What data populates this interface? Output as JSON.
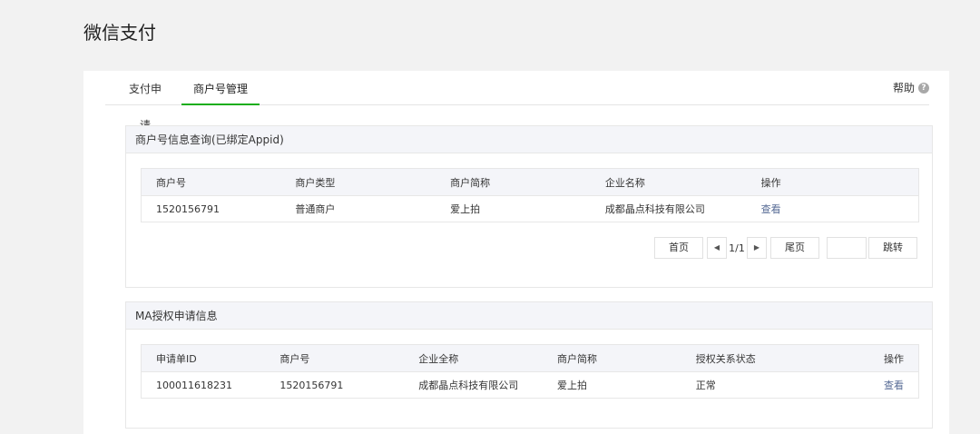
{
  "page": {
    "title": "微信支付"
  },
  "tabs": [
    {
      "label": "支付申请"
    },
    {
      "label": "商户号管理",
      "active": true
    }
  ],
  "help": {
    "label": "帮助",
    "icon": "question-icon",
    "glyph": "?"
  },
  "merchant_section": {
    "title": "商户号信息查询(已绑定Appid)",
    "columns": [
      "商户号",
      "商户类型",
      "商户简称",
      "企业名称",
      "操作"
    ],
    "rows": [
      {
        "merchant_id": "1520156791",
        "type": "普通商户",
        "short_name": "爱上拍",
        "company": "成都晶点科技有限公司",
        "action": "查看"
      }
    ],
    "pager": {
      "first": "首页",
      "prev_icon": "caret-left-icon",
      "prev_glyph": "◀",
      "page_text": "1/1",
      "next_icon": "caret-right-icon",
      "next_glyph": "▶",
      "last": "尾页",
      "jump_input": "",
      "jump": "跳转"
    }
  },
  "ma_section": {
    "title": "MA授权申请信息",
    "columns": [
      "申请单ID",
      "商户号",
      "企业全称",
      "商户简称",
      "授权关系状态",
      "操作"
    ],
    "rows": [
      {
        "apply_id": "100011618231",
        "merchant_id": "1520156791",
        "company": "成都晶点科技有限公司",
        "short_name": "爱上拍",
        "status": "正常",
        "action": "查看"
      }
    ]
  },
  "colors": {
    "accent_green": "#1aad19",
    "link_blue": "#576b95",
    "header_bg": "#f4f5f9"
  }
}
